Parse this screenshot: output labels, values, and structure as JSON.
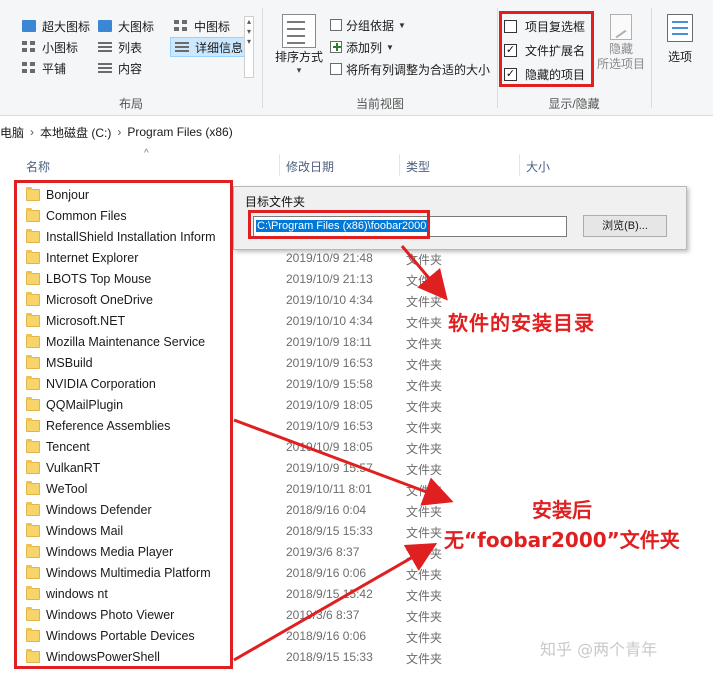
{
  "ribbon": {
    "layout": {
      "items": [
        [
          "超大图标",
          "大图标",
          "中图标"
        ],
        [
          "小图标",
          "列表",
          "详细信息"
        ],
        [
          "平铺",
          "内容",
          ""
        ]
      ],
      "selected": "详细信息",
      "group_label": "布局"
    },
    "current_view": {
      "sort_label": "排序方式",
      "group_by": "分组依据",
      "add_column": "添加列",
      "fit_columns": "将所有列调整为合适的大小",
      "group_label": "当前视图"
    },
    "show_hide": {
      "checkboxes": [
        {
          "label": "项目复选框",
          "checked": false
        },
        {
          "label": "文件扩展名",
          "checked": true
        },
        {
          "label": "隐藏的项目",
          "checked": true
        }
      ],
      "hide_selected_line1": "隐藏",
      "hide_selected_line2": "所选项目",
      "group_label": "显示/隐藏"
    },
    "options_label": "选项"
  },
  "address": {
    "crumbs": [
      "电脑",
      "本地磁盘 (C:)",
      "Program Files (x86)"
    ]
  },
  "columns": {
    "name": "名称",
    "date": "修改日期",
    "type": "类型",
    "size": "大小"
  },
  "files": [
    {
      "name": "Bonjour",
      "date": "",
      "type": ""
    },
    {
      "name": "Common Files",
      "date": "",
      "type": ""
    },
    {
      "name": "InstallShield Installation Inform",
      "date": "",
      "type": ""
    },
    {
      "name": "Internet Explorer",
      "date": "2019/10/9 21:48",
      "type": "文件夹"
    },
    {
      "name": "LBOTS Top Mouse",
      "date": "2019/10/9 21:13",
      "type": "文件夹"
    },
    {
      "name": "Microsoft OneDrive",
      "date": "2019/10/10 4:34",
      "type": "文件夹"
    },
    {
      "name": "Microsoft.NET",
      "date": "2019/10/10 4:34",
      "type": "文件夹"
    },
    {
      "name": "Mozilla Maintenance Service",
      "date": "2019/10/9 18:11",
      "type": "文件夹"
    },
    {
      "name": "MSBuild",
      "date": "2019/10/9 16:53",
      "type": "文件夹"
    },
    {
      "name": "NVIDIA Corporation",
      "date": "2019/10/9 15:58",
      "type": "文件夹"
    },
    {
      "name": "QQMailPlugin",
      "date": "2019/10/9 18:05",
      "type": "文件夹"
    },
    {
      "name": "Reference Assemblies",
      "date": "2019/10/9 16:53",
      "type": "文件夹"
    },
    {
      "name": "Tencent",
      "date": "2019/10/9 18:05",
      "type": "文件夹"
    },
    {
      "name": "VulkanRT",
      "date": "2019/10/9 15:57",
      "type": "文件夹"
    },
    {
      "name": "WeTool",
      "date": "2019/10/11 8:01",
      "type": "文件夹"
    },
    {
      "name": "Windows Defender",
      "date": "2018/9/16 0:04",
      "type": "文件夹"
    },
    {
      "name": "Windows Mail",
      "date": "2018/9/15 15:33",
      "type": "文件夹"
    },
    {
      "name": "Windows Media Player",
      "date": "2019/3/6 8:37",
      "type": "文件夹"
    },
    {
      "name": "Windows Multimedia Platform",
      "date": "2018/9/16 0:06",
      "type": "文件夹"
    },
    {
      "name": "windows nt",
      "date": "2018/9/15 15:42",
      "type": "文件夹"
    },
    {
      "name": "Windows Photo Viewer",
      "date": "2019/3/6 8:37",
      "type": "文件夹"
    },
    {
      "name": "Windows Portable Devices",
      "date": "2018/9/16 0:06",
      "type": "文件夹"
    },
    {
      "name": "WindowsPowerShell",
      "date": "2018/9/15 15:33",
      "type": "文件夹"
    }
  ],
  "dialog": {
    "title": "目标文件夹",
    "path": "C:\\Program Files (x86)\\foobar2000",
    "browse": "浏览(B)..."
  },
  "annotations": {
    "install_dir": "软件的安装目录",
    "after_install": "安装后",
    "no_folder": "无“foobar2000”文件夹"
  },
  "watermark": "知乎 @两个青年",
  "colors": {
    "highlight_red": "#e02020",
    "selection_blue": "#0078d7",
    "folder_yellow": "#f8d56a"
  }
}
